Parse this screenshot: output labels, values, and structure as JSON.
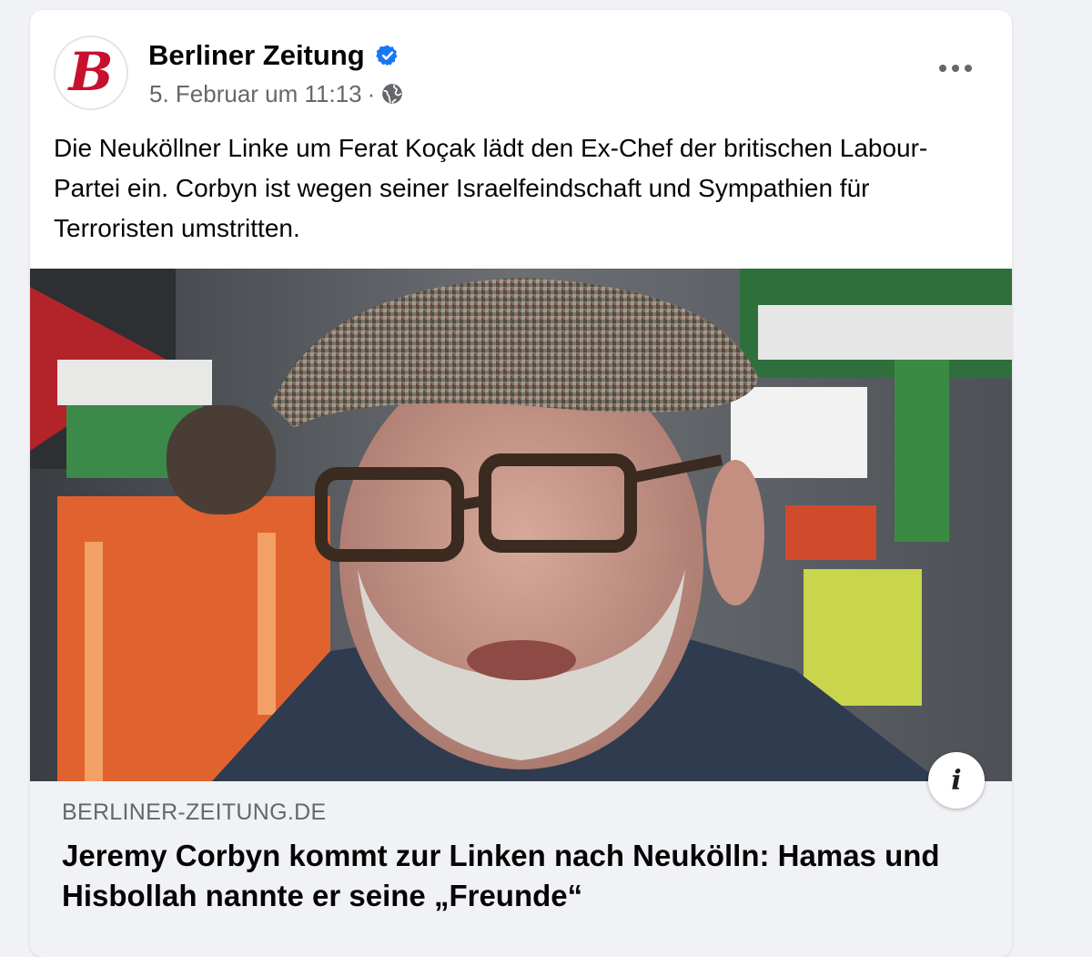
{
  "post": {
    "page_name": "Berliner Zeitung",
    "verified": true,
    "timestamp": "5. Februar um 11:13",
    "separator": "·",
    "audience_icon": "globe-icon",
    "more_icon": "more-horizontal-icon",
    "avatar_letter": "B",
    "text": "Die Neuköllner Linke um Ferat Koçak lädt den Ex-Chef der britischen Labour-Partei ein. Corbyn ist wegen seiner Israelfeindschaft und Sympathien für Terroristen umstritten."
  },
  "link": {
    "domain": "BERLINER-ZEITUNG.DE",
    "title": "Jeremy Corbyn kommt zur Linken nach Neukölln: Hamas und Hisbollah nannte er seine „Freunde“",
    "info_label": "i"
  },
  "colors": {
    "verified_blue": "#1877f2",
    "brand_red": "#c8102e",
    "secondary_text": "#65676b",
    "primary_text": "#050505"
  }
}
